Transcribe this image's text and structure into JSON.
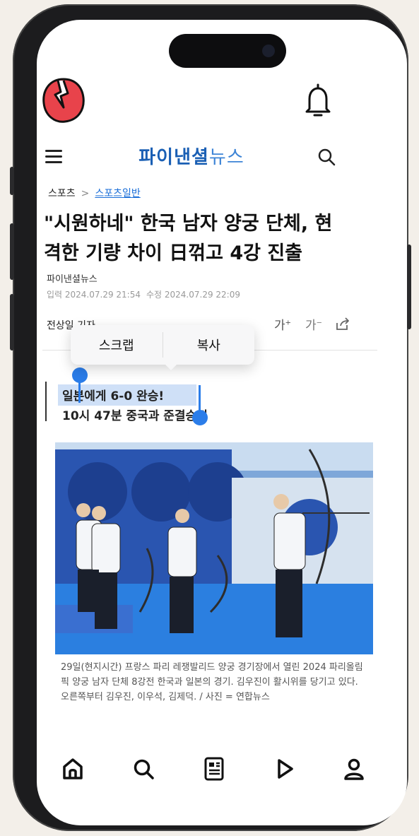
{
  "header": {
    "brand_name": "파이낸셜",
    "brand_suffix": "뉴스"
  },
  "article": {
    "breadcrumb": {
      "section": "스포츠",
      "separator": ">",
      "subsection": "스포츠일반"
    },
    "headline_line1": "\"시원하네\" 한국 남자 양궁 단체, 현",
    "headline_line2": "격한 기량 차이 日꺾고 4강 진출",
    "source": "파이낸셜뉴스",
    "published": "입력 2024.07.29 21:54",
    "modified": "수정 2024.07.29 22:09",
    "reporter": "전상일 기자",
    "font_up_label": "가",
    "font_down_label": "가",
    "subheadline_1": "일본에게 6-0 완승!",
    "subheadline_2": "10시 47분 중국과 준결승전",
    "caption": "29일(현지시간) 프랑스 파리 레쟁발리드 양궁 경기장에서 열린 2024 파리올림픽 양궁 남자 단체 8강전 한국과 일본의 경기. 김우진이 활시위를 당기고 있다. 오른쪽부터 김우진, 이우석, 김제덕. / 사진 = 연합뉴스"
  },
  "context_menu": {
    "scrap_label": "스크랩",
    "copy_label": "복사"
  },
  "tabbar": {
    "items": [
      {
        "icon": "home-icon"
      },
      {
        "icon": "search-icon"
      },
      {
        "icon": "news-icon"
      },
      {
        "icon": "play-icon"
      },
      {
        "icon": "profile-icon"
      }
    ]
  },
  "colors": {
    "brand": "#1a5fb4",
    "selection": "#2b7de9",
    "highlight": "#cfe0f7"
  }
}
